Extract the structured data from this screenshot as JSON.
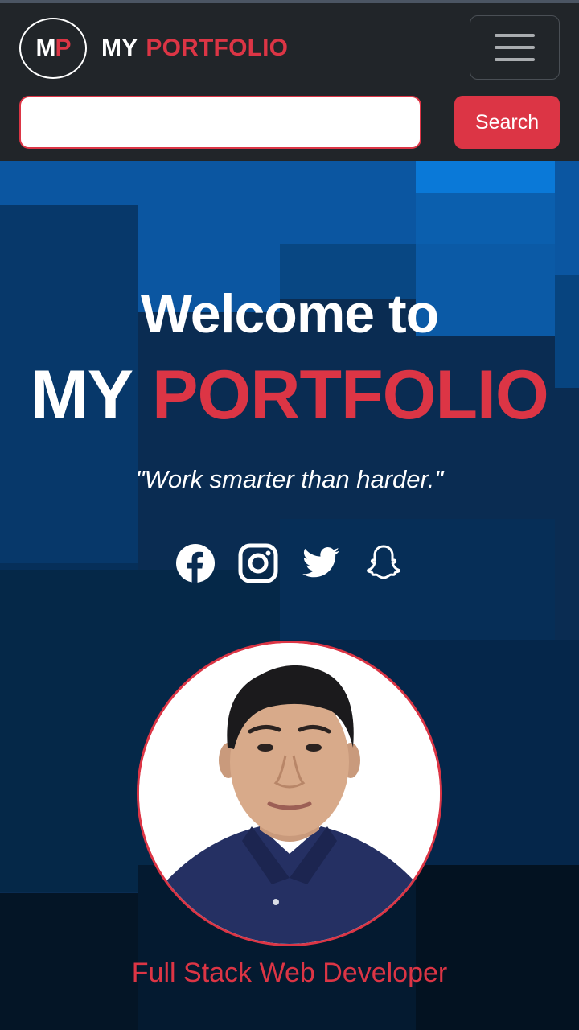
{
  "navbar": {
    "logo": {
      "first_letter": "M",
      "second_letter": "P"
    },
    "brand": {
      "my": "MY",
      "portfolio": "PORTFOLIO"
    },
    "menu_icon": "hamburger-menu-icon",
    "search": {
      "value": "",
      "placeholder": "",
      "button_label": "Search"
    }
  },
  "hero": {
    "welcome": "Welcome to",
    "title_my": "MY",
    "title_portfolio": "PORTFOLIO",
    "quote": "\"Work smarter than harder.\"",
    "social_icons": [
      "facebook-icon",
      "instagram-icon",
      "twitter-icon",
      "snapchat-icon"
    ],
    "role": "Full Stack Web Developer"
  },
  "colors": {
    "accent": "#dc3545",
    "navbar_bg": "#212529",
    "hero_bg": "#0a2c52",
    "text_light": "#ffffff"
  }
}
